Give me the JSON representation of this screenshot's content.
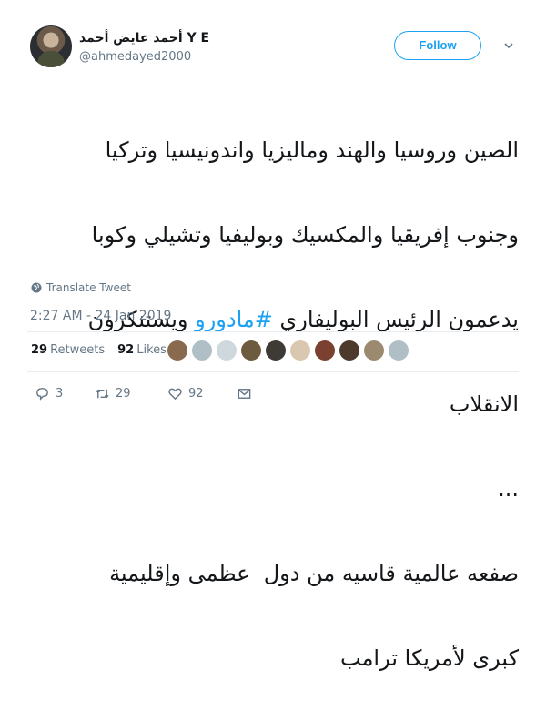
{
  "user": {
    "display_name": "أحمد عايض أحمد Y E",
    "handle": "@ahmedayed2000"
  },
  "follow_label": "Follow",
  "tweet": {
    "lines": [
      {
        "text": "الصين وروسيا والهند وماليزيا واندونيسيا وتركيا"
      },
      {
        "text": "وجنوب إفريقيا والمكسيك وبوليفيا وتشيلي وكوبا"
      },
      {
        "before": "يدعمون الرئيس البوليفاري ",
        "hashtag": "#مادورو",
        "after": " ويستنكرون"
      },
      {
        "text": "الانقلاب"
      },
      {
        "text": "..."
      },
      {
        "text": "صفعه عالمية قاسيه من دول  عظمى وإقليمية"
      },
      {
        "text": "كبرى لأمريكا ترامب"
      }
    ]
  },
  "translate_label": "Translate Tweet",
  "timestamp": "2:27 AM - 24 Jan 2019",
  "stats": {
    "retweets_count": "29",
    "retweets_label": "Retweets",
    "likes_count": "92",
    "likes_label": "Likes"
  },
  "liker_faces": [
    {
      "color": "#8a6a4f"
    },
    {
      "color": "#b0bec5"
    },
    {
      "color": "#cfd8dc"
    },
    {
      "color": "#6d5b3f"
    },
    {
      "color": "#3e3a36"
    },
    {
      "color": "#d9c7b0"
    },
    {
      "color": "#7a4030"
    },
    {
      "color": "#4d3a2c"
    },
    {
      "color": "#9c8a70"
    },
    {
      "color": "#b0bec5"
    }
  ],
  "actions": {
    "replies": "3",
    "retweets": "29",
    "likes": "92"
  },
  "colors": {
    "accent": "#1da1f2",
    "muted": "#657786",
    "text": "#14171a"
  }
}
